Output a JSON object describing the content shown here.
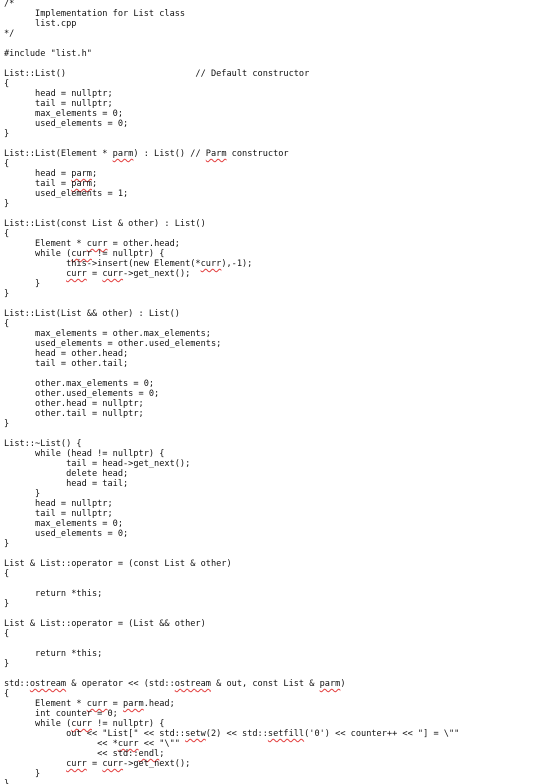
{
  "document": {
    "spellcheck_flagged_words": [
      "parm",
      "Parm",
      "curr",
      "ostream",
      "setw",
      "setfill",
      "endl"
    ],
    "spellcheck_underline_color": "#e23b3b",
    "text_color": "#111111",
    "background_color": "#ffffff",
    "lines": [
      "/*",
      "      Implementation for List class",
      "      list.cpp",
      "*/",
      "",
      "#include \"list.h\"",
      "",
      "List::List()                         // Default constructor",
      "{",
      "      head = nullptr;",
      "      tail = nullptr;",
      "      max_elements = 0;",
      "      used_elements = 0;",
      "}",
      "",
      "List::List(Element * parm) : List() // Parm constructor",
      "{",
      "      head = parm;",
      "      tail = parm;",
      "      used_elements = 1;",
      "}",
      "",
      "List::List(const List & other) : List()",
      "{",
      "      Element * curr = other.head;",
      "      while (curr != nullptr) {",
      "            this->insert(new Element(*curr),-1);",
      "            curr = curr->get_next();",
      "      }",
      "}",
      "",
      "List::List(List && other) : List()",
      "{",
      "      max_elements = other.max_elements;",
      "      used_elements = other.used_elements;",
      "      head = other.head;",
      "      tail = other.tail;",
      "",
      "      other.max_elements = 0;",
      "      other.used_elements = 0;",
      "      other.head = nullptr;",
      "      other.tail = nullptr;",
      "}",
      "",
      "List::~List() {",
      "      while (head != nullptr) {",
      "            tail = head->get_next();",
      "            delete head;",
      "            head = tail;",
      "      }",
      "      head = nullptr;",
      "      tail = nullptr;",
      "      max_elements = 0;",
      "      used_elements = 0;",
      "}",
      "",
      "List & List::operator = (const List & other)",
      "{",
      "",
      "      return *this;",
      "}",
      "",
      "List & List::operator = (List && other)",
      "{",
      "",
      "      return *this;",
      "}",
      "",
      "std::ostream & operator << (std::ostream & out, const List & parm)",
      "{",
      "      Element * curr = parm.head;",
      "      int counter = 0;",
      "      while (curr != nullptr) {",
      "            out << \"List[\" << std::setw(2) << std::setfill('0') << counter++ << \"] = \\\"\"",
      "                  << *curr << \"\\\"\"",
      "                  << std::endl;",
      "            curr = curr->get_next();",
      "      }",
      "}"
    ]
  }
}
